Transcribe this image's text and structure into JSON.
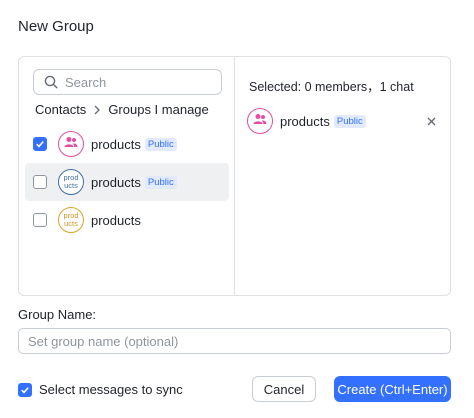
{
  "dialog": {
    "title": "New Group"
  },
  "search": {
    "placeholder": "Search"
  },
  "breadcrumb": {
    "root": "Contacts",
    "current": "Groups I manage"
  },
  "list": {
    "items": [
      {
        "name": "products",
        "tag": "Public",
        "checked": true,
        "avatar_style": "icon",
        "avatar_color": "#e34fa0"
      },
      {
        "name": "products",
        "tag": "Public",
        "checked": false,
        "avatar_text": "products",
        "avatar_color": "#3f6ea8"
      },
      {
        "name": "products",
        "checked": false,
        "avatar_text": "products",
        "avatar_color": "#d9a52a"
      }
    ]
  },
  "selected": {
    "summary": "Selected: 0 members，1 chat",
    "items": [
      {
        "name": "products",
        "tag": "Public",
        "avatar_color": "#e34fa0"
      }
    ]
  },
  "group_name": {
    "label": "Group Name:",
    "placeholder": "Set group name (optional)"
  },
  "sync": {
    "label": "Select messages to sync",
    "checked": true
  },
  "buttons": {
    "cancel": "Cancel",
    "create": "Create (Ctrl+Enter)"
  },
  "colors": {
    "accent": "#3370ff",
    "tag_bg": "#e1eaff",
    "border": "#dee0e3"
  }
}
